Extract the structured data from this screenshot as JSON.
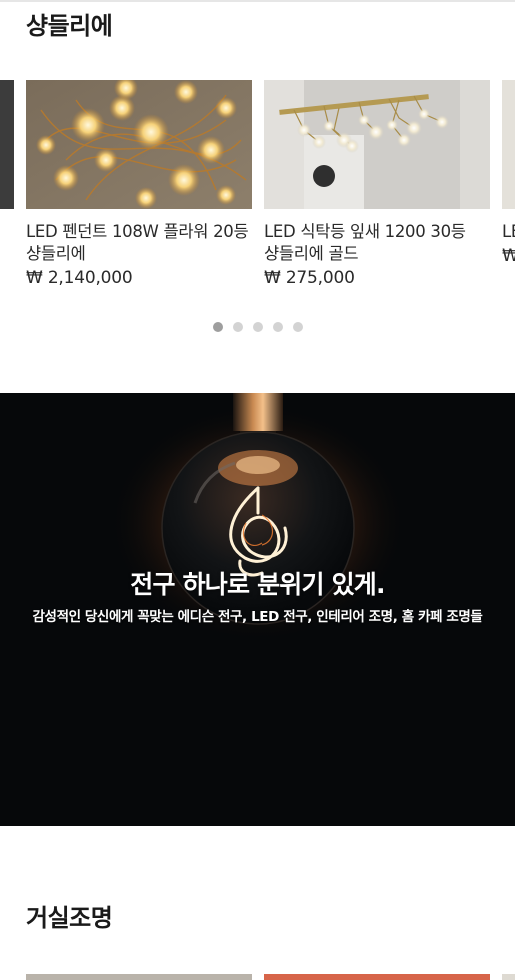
{
  "sections": {
    "chandelier_title": "샹들리에",
    "living_title": "거실조명"
  },
  "products": [
    {
      "name": "",
      "price": ""
    },
    {
      "name": "LED 펜던트 108W 플라워 20등 샹들리에",
      "price": "₩ 2,140,000"
    },
    {
      "name": "LED 식탁등 잎새 1200 30등 샹들리에 골드",
      "price": "₩ 275,000"
    },
    {
      "name": "LE 등",
      "price": "₩"
    }
  ],
  "carousel": {
    "page_count": 5,
    "active_index": 0
  },
  "banner": {
    "headline": "전구 하나로 분위기 있게.",
    "subtext": "감성적인 당신에게 꼭맞는 에디슨 전구, LED 전구, 인테리어 조명, 홈 카페 조명들"
  },
  "colors": {
    "banner_bg": "#06080a",
    "dot_active": "#9e9e9e",
    "dot_inactive": "#d3d3d3"
  }
}
